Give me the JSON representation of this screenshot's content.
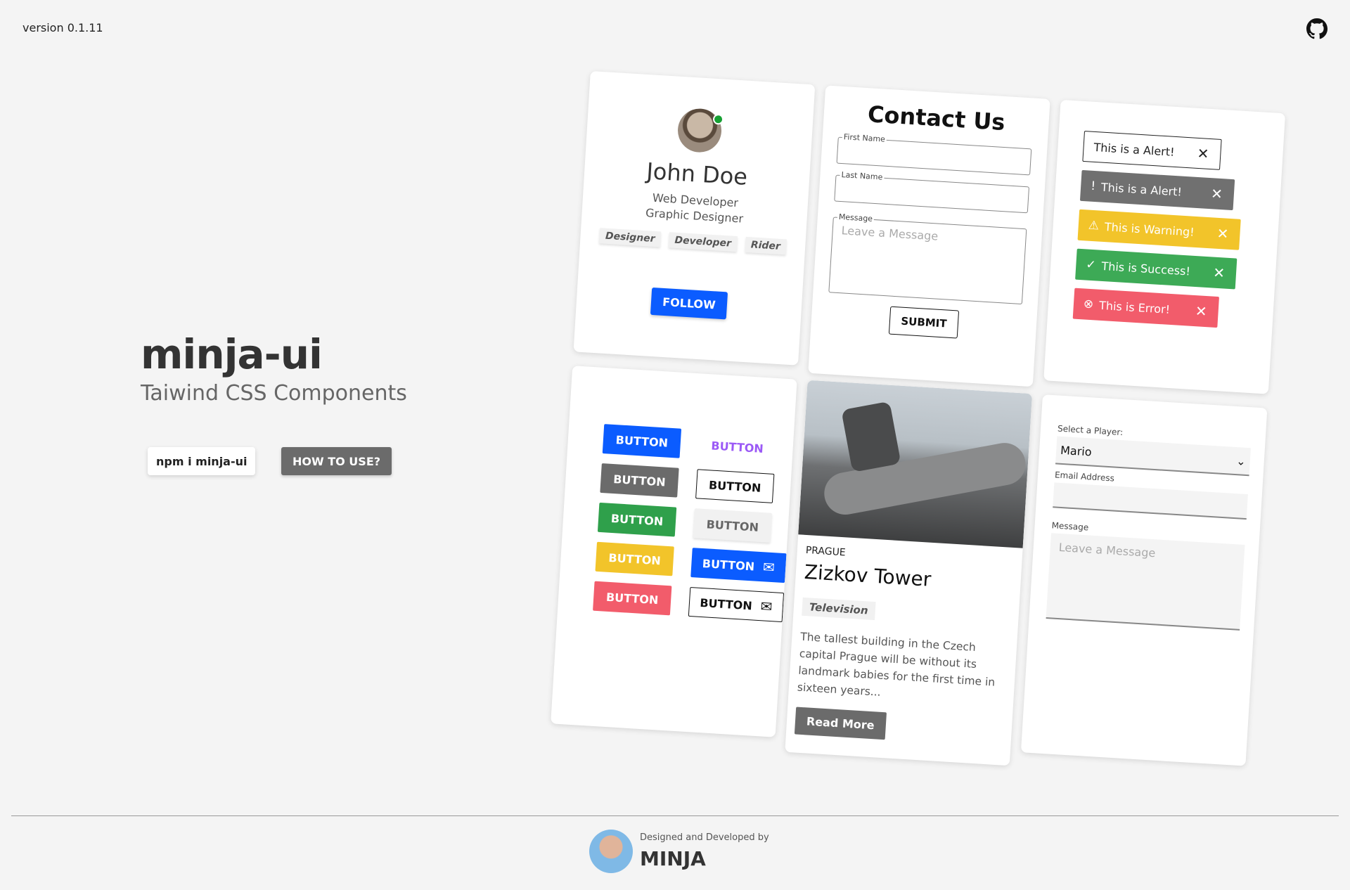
{
  "header": {
    "version": "version 0.1.11",
    "github_icon": "github-icon"
  },
  "hero": {
    "title": "minja-ui",
    "subtitle": "Taiwind CSS Components",
    "npm_label": "npm i minja-ui",
    "howto_label": "HOW TO USE?"
  },
  "profile": {
    "name": "John Doe",
    "role1": "Web Developer",
    "role2": "Graphic Designer",
    "tags": [
      "Designer",
      "Developer",
      "Rider"
    ],
    "follow": "FOLLOW"
  },
  "contact": {
    "title": "Contact Us",
    "first_name": "First Name",
    "last_name": "Last Name",
    "message": "Message",
    "message_placeholder": "Leave a Message",
    "submit": "SUBMIT"
  },
  "alerts": [
    {
      "text": "This is a Alert!",
      "close": "✕"
    },
    {
      "text": "This is a Alert!",
      "close": "✕",
      "icon": "!"
    },
    {
      "text": "This is Warning!",
      "close": "✕",
      "icon": "⚠"
    },
    {
      "text": "This is Success!",
      "close": "✕",
      "icon": "✓"
    },
    {
      "text": "This is Error!",
      "close": "✕",
      "icon": "⊗"
    }
  ],
  "buttons": {
    "label": "BUTTON",
    "mail_icon": "✉"
  },
  "article": {
    "city": "PRAGUE",
    "title": "Zizkov Tower",
    "tag": "Television",
    "desc": "The tallest building in the Czech capital Prague will be without its landmark babies for the first time in sixteen years...",
    "read_more": "Read More"
  },
  "form2": {
    "player_label": "Select a Player:",
    "player_value": "Mario",
    "email_label": "Email Address",
    "message_label": "Message",
    "message_placeholder": "Leave a Message"
  },
  "footer": {
    "credit": "Designed and Developed by",
    "author": "MINJA"
  },
  "colors": {
    "primary": "#0b5cff",
    "grey": "#6b6b6b",
    "success": "#3daa56",
    "warning": "#f2c42a",
    "error": "#f25c6b"
  }
}
